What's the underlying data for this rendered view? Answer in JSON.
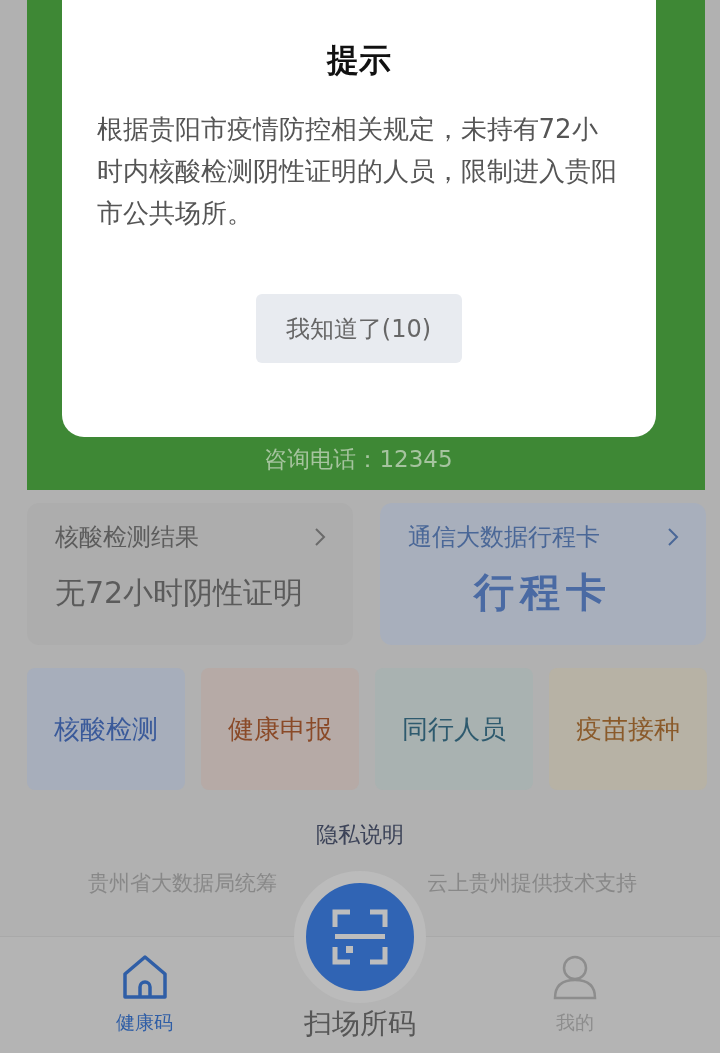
{
  "dialog": {
    "title": "提示",
    "message": "根据贵阳市疫情防控相关规定，未持有72小时内核酸检测阴性证明的人员，限制进入贵阳市公共场所。",
    "button": "我知道了(10)"
  },
  "hotline": "咨询电话：12345",
  "cards": [
    {
      "kind": "status",
      "title": "核酸检测结果",
      "value": "无72小时阴性证明"
    },
    {
      "kind": "link",
      "title": "通信大数据行程卡",
      "value": "行程卡"
    }
  ],
  "services": [
    {
      "label": "核酸检测",
      "color": "#a7aebb"
    },
    {
      "label": "健康申报",
      "color": "#b6aaa6"
    },
    {
      "label": "同行人员",
      "color": "#a9b2b1"
    },
    {
      "label": "疫苗接种",
      "color": "#b7b2a5"
    }
  ],
  "privacy_link": "隐私说明",
  "footer": {
    "left": "贵州省大数据局统筹",
    "right": "云上贵州提供技术支持"
  },
  "tabs": [
    {
      "kind": "home",
      "label": "健康码",
      "selected": true
    },
    {
      "kind": "scan",
      "label": "扫场所码",
      "selected": false
    },
    {
      "kind": "profile",
      "label": "我的",
      "selected": false
    }
  ]
}
